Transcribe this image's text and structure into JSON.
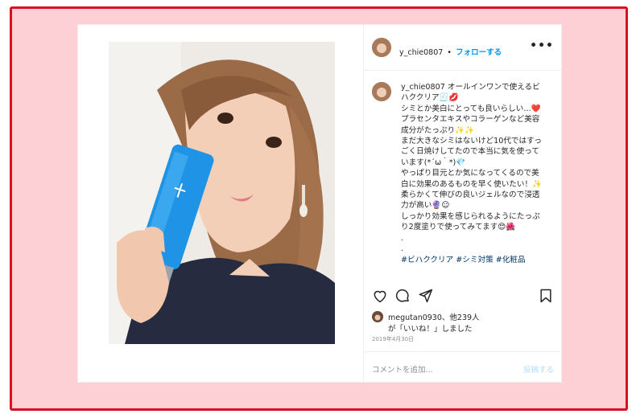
{
  "post": {
    "username": "y_chie0807",
    "separator": "•",
    "follow_label": "フォローする",
    "more_label": "•••",
    "caption_user": "y_chie0807",
    "caption_text": "オールインワンで使えるビハククリア🧾💋\nシミとか美白にとっても良いらしい…❤️\nプラセンタエキスやコラーゲンなど美容成分がたっぷり✨✨\nまだ大きなシミはないけど10代ではすっごく日焼けしてたので本当に気を使っています(*´ω｀*)💎\nやっぱり目元とか気になってくるので美白に効果のあるものを早く使いたい！✨\n柔らかくて伸びの良いジェルなので浸透力が高い🔮☺︎\nしっかり効果を感じられるようにたっぷり2度塗りで使ってみてます😍🌺\n.\n.",
    "hashtags": "#ビハククリア #シミ対策 #化粧品",
    "likes_user": "megutan0930",
    "likes_suffix": "、他239人",
    "likes_line2": "が「いいね！」しました",
    "date": "2019年4月30日",
    "comment_placeholder": "コメントを追加...",
    "post_button": "投稿する"
  },
  "colors": {
    "frame_border": "#d90f24",
    "frame_fill": "#fcd0d4",
    "link_blue": "#0095f6"
  }
}
